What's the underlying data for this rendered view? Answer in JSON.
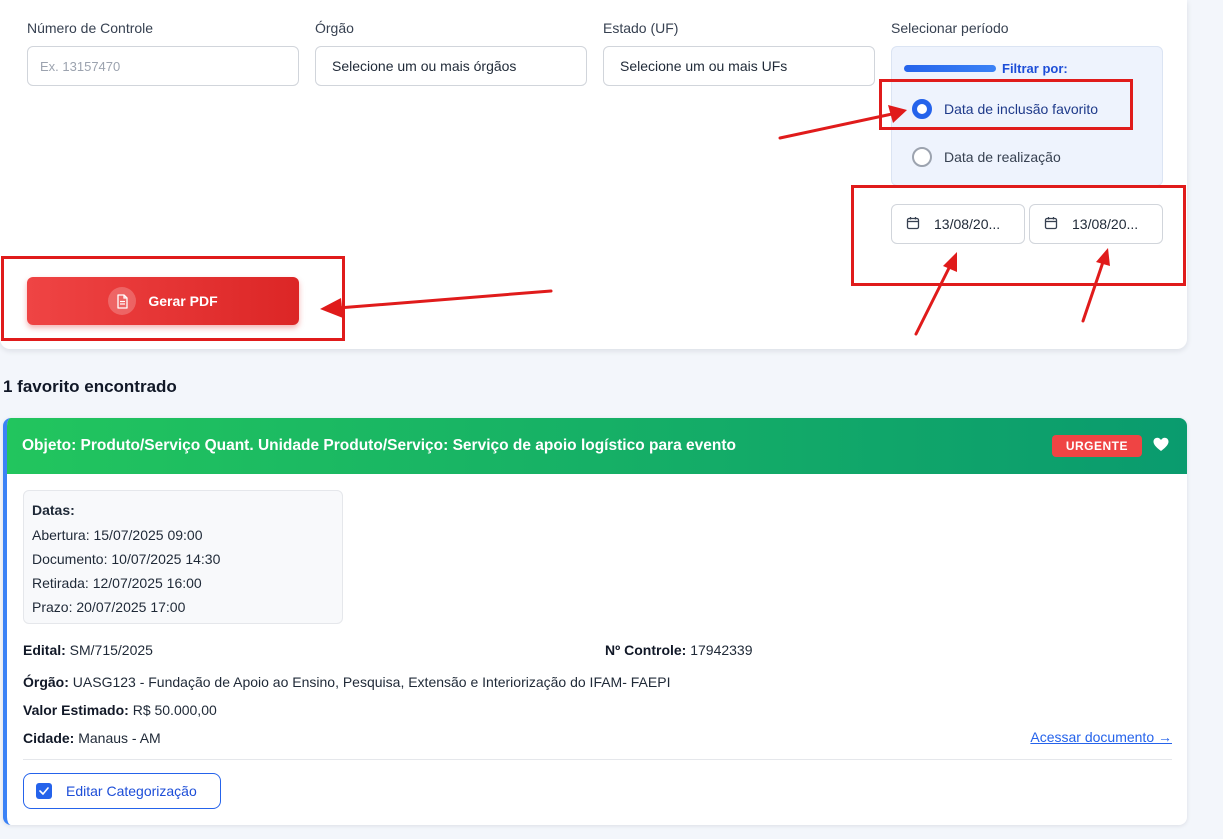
{
  "filters": {
    "control_number": {
      "label": "Número de Controle",
      "placeholder": "Ex. 13157470"
    },
    "organ": {
      "label": "Órgão",
      "value": "Selecione um ou mais órgãos"
    },
    "state": {
      "label": "Estado (UF)",
      "value": "Selecione um ou mais UFs"
    },
    "period": {
      "label": "Selecionar período",
      "filter_by_label": "Filtrar por:",
      "options": [
        {
          "label": "Data de inclusão favorito",
          "selected": true
        },
        {
          "label": "Data de realização",
          "selected": false
        }
      ],
      "date_start": "13/08/20...",
      "date_end": "13/08/20..."
    },
    "generate_pdf_label": "Gerar PDF"
  },
  "results": {
    "count_text": "1 favorito encontrado",
    "cards": [
      {
        "title": "Objeto: Produto/Serviço Quant. Unidade Produto/Serviço: Serviço de apoio logístico para evento",
        "badge": "URGENTE",
        "dates": {
          "title": "Datas:",
          "items": [
            {
              "label": "Abertura:",
              "value": "15/07/2025 09:00"
            },
            {
              "label": "Documento:",
              "value": "10/07/2025 14:30"
            },
            {
              "label": "Retirada:",
              "value": "12/07/2025 16:00"
            },
            {
              "label": "Prazo:",
              "value": "20/07/2025 17:00"
            }
          ]
        },
        "edital": {
          "label": "Edital:",
          "value": "SM/715/2025"
        },
        "control": {
          "label": "Nº Controle:",
          "value": "17942339"
        },
        "organ": {
          "label": "Órgão:",
          "value": "UASG123 - Fundação de Apoio ao Ensino, Pesquisa, Extensão e Interiorização do IFAM- FAEPI"
        },
        "estimated_value": {
          "label": "Valor Estimado:",
          "value": "R$ 50.000,00"
        },
        "city": {
          "label": "Cidade:",
          "value": "Manaus - AM"
        },
        "document_link": "Acessar documento →",
        "edit_button": "Editar Categorização"
      }
    ]
  },
  "colors": {
    "annotation_red": "#e01b1b",
    "pdf_button": "#dc2626",
    "card_header_start": "#22c55e",
    "card_header_end": "#0a9b6e",
    "accent_blue": "#2563eb",
    "urgent": "#ef4444"
  },
  "icons": {
    "pdf_button": "document-icon",
    "date_buttons": "calendar-icon",
    "favorite": "heart-icon",
    "edit_button": "checkbox-icon"
  }
}
